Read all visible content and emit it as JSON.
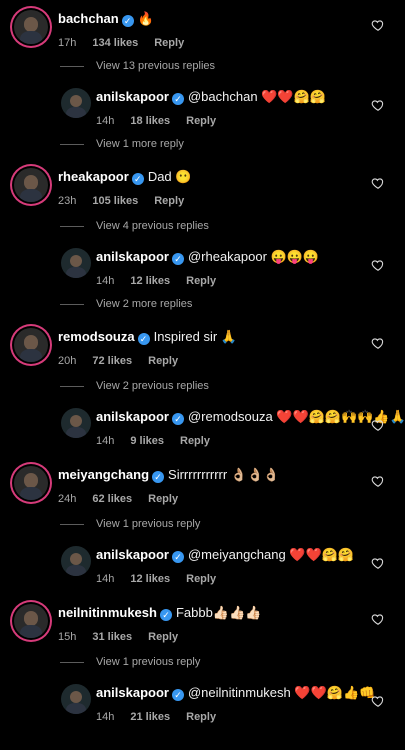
{
  "items": [
    {
      "kind": "comment",
      "username": "bachchan",
      "text": "🔥",
      "time": "17h",
      "likes": "134 likes",
      "reply": "Reply"
    },
    {
      "kind": "view",
      "text": "View 13 previous replies"
    },
    {
      "kind": "reply",
      "username": "anilskapoor",
      "text": "@bachchan ❤️❤️🤗🤗",
      "time": "14h",
      "likes": "18 likes",
      "reply": "Reply"
    },
    {
      "kind": "view",
      "text": "View 1 more reply"
    },
    {
      "kind": "comment",
      "username": "rheakapoor",
      "text": "Dad 😶",
      "time": "23h",
      "likes": "105 likes",
      "reply": "Reply"
    },
    {
      "kind": "view",
      "text": "View 4 previous replies"
    },
    {
      "kind": "reply",
      "username": "anilskapoor",
      "text": "@rheakapoor 😛😛😛",
      "time": "14h",
      "likes": "12 likes",
      "reply": "Reply"
    },
    {
      "kind": "view",
      "text": "View 2 more replies"
    },
    {
      "kind": "comment",
      "username": "remodsouza",
      "text": "Inspired sir 🙏",
      "time": "20h",
      "likes": "72 likes",
      "reply": "Reply"
    },
    {
      "kind": "view",
      "text": "View 2 previous replies"
    },
    {
      "kind": "reply",
      "username": "anilskapoor",
      "text": "@remodsouza ❤️❤️🤗🤗🙌🙌👍🙏",
      "time": "14h",
      "likes": "9 likes",
      "reply": "Reply"
    },
    {
      "kind": "comment",
      "username": "meiyangchang",
      "text": "Sirrrrrrrrrrr 👌🏼👌🏼👌🏼",
      "time": "24h",
      "likes": "62 likes",
      "reply": "Reply"
    },
    {
      "kind": "view",
      "text": "View 1 previous reply"
    },
    {
      "kind": "reply",
      "username": "anilskapoor",
      "text": "@meiyangchang ❤️❤️🤗🤗",
      "time": "14h",
      "likes": "12 likes",
      "reply": "Reply"
    },
    {
      "kind": "comment",
      "username": "neilnitinmukesh",
      "text": "Fabbb👍🏻👍🏻👍🏻",
      "time": "15h",
      "likes": "31 likes",
      "reply": "Reply"
    },
    {
      "kind": "view",
      "text": "View 1 previous reply"
    },
    {
      "kind": "reply",
      "username": "anilskapoor",
      "text": "@neilnitinmukesh ❤️❤️🤗👍👊",
      "time": "14h",
      "likes": "21 likes",
      "reply": "Reply"
    }
  ],
  "icons": {
    "verified": "verified-badge-icon",
    "like": "heart-outline-icon"
  },
  "colors": {
    "background": "#000000",
    "verified": "#3897f0",
    "story_ring": "#d63b7a",
    "secondary_text": "#a8a8a8"
  }
}
